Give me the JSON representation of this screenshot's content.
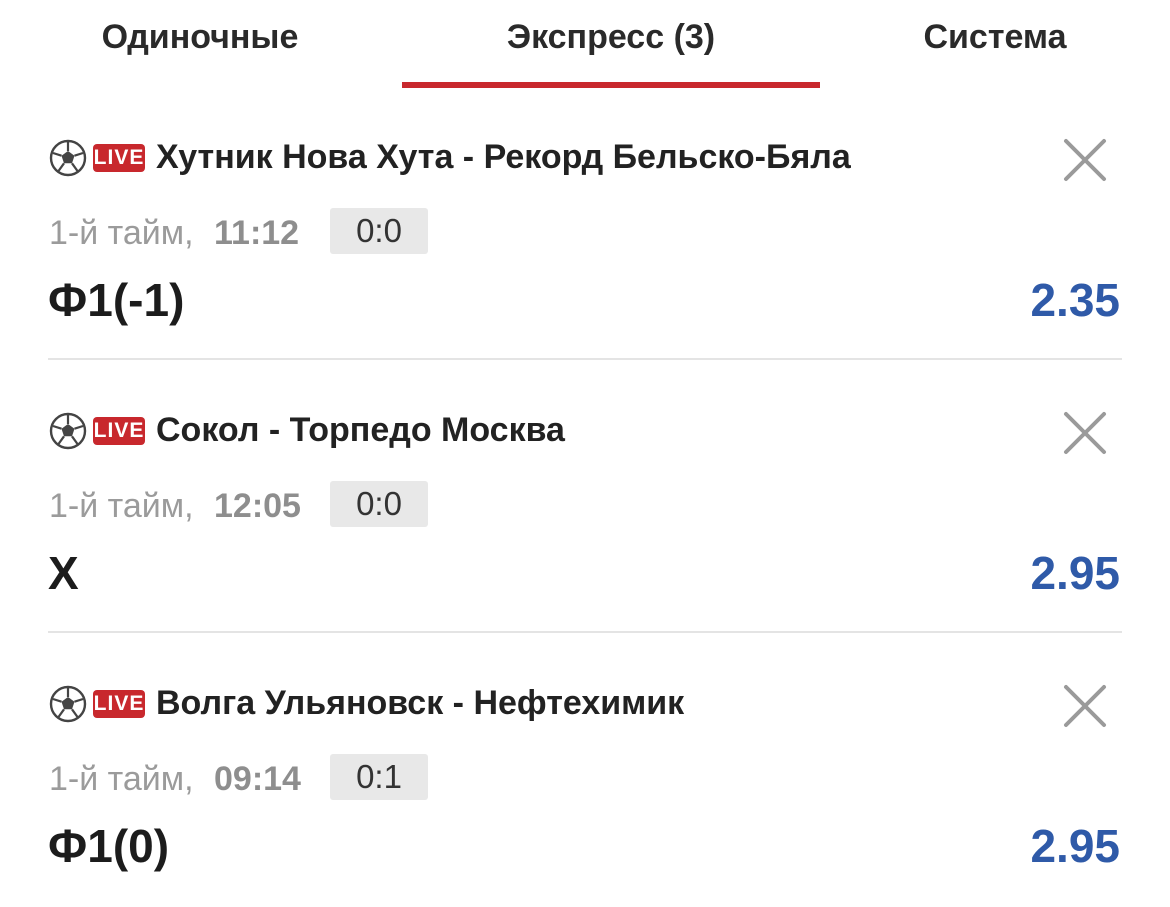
{
  "colors": {
    "accent": "#c8282d",
    "odds": "#2f5aa8",
    "live_badge": "#c8282d"
  },
  "tabs": [
    {
      "label": "Одиночные",
      "active": false
    },
    {
      "label": "Экспресс (3)",
      "active": true
    },
    {
      "label": "Система",
      "active": false
    }
  ],
  "bets": [
    {
      "sport_icon": "soccer-ball-icon",
      "live_label": "LIVE",
      "match": "Хутник Нова Хута - Рекорд Бельско-Бяла",
      "period": "1-й тайм,",
      "time": "11:12",
      "score": "0:0",
      "outcome": "Ф1(-1)",
      "odds": "2.35"
    },
    {
      "sport_icon": "soccer-ball-icon",
      "live_label": "LIVE",
      "match": "Сокол - Торпедо Москва",
      "period": "1-й тайм,",
      "time": "12:05",
      "score": "0:0",
      "outcome": "X",
      "odds": "2.95"
    },
    {
      "sport_icon": "soccer-ball-icon",
      "live_label": "LIVE",
      "match": "Волга Ульяновск - Нефтехимик",
      "period": "1-й тайм,",
      "time": "09:14",
      "score": "0:1",
      "outcome": "Ф1(0)",
      "odds": "2.95"
    }
  ]
}
